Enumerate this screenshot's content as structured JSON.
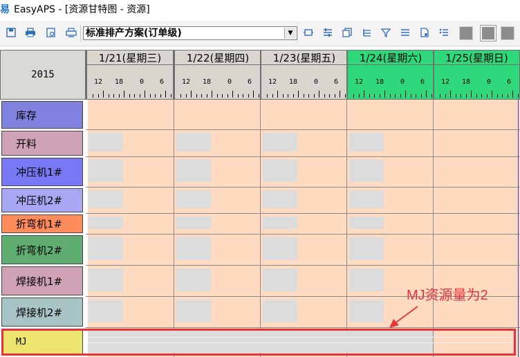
{
  "window": {
    "app_icon": "easyaps-logo-icon",
    "title": "EasyAPS - [资源甘特图 - 资源]"
  },
  "toolbar": {
    "icons_left": [
      "save-icon",
      "print-icon",
      "print-preview-icon",
      "printer-setup-icon"
    ],
    "scheme_value": "标准排产方案(订单级)",
    "dropdown_arrow": "▼",
    "icons_right": [
      "refresh-icon",
      "align-icon",
      "copy-icon",
      "indent-icon",
      "filter-icon",
      "list-icon",
      "document-icon",
      "sort-icon"
    ],
    "view_squares": [
      "view-square-1",
      "view-square-2",
      "view-square-3"
    ]
  },
  "gantt": {
    "year": "2015",
    "days": [
      {
        "label": "1/21(星期三)",
        "highlight": false
      },
      {
        "label": "1/22(星期四)",
        "highlight": false
      },
      {
        "label": "1/23(星期五)",
        "highlight": false
      },
      {
        "label": "1/24(星期六)",
        "highlight": true
      },
      {
        "label": "1/25(星期日)",
        "highlight": true
      }
    ],
    "hour_ticks": [
      "12",
      "18",
      "0",
      "6"
    ],
    "resources": [
      {
        "name": "库存",
        "color": "#8181e0"
      },
      {
        "name": "开料",
        "color": "#cfa2b6"
      },
      {
        "name": "冲压机1#",
        "color": "#7878f5"
      },
      {
        "name": "冲压机2#",
        "color": "#a9a7f4"
      },
      {
        "name": "折弯机1#",
        "color": "#ff8c5a"
      },
      {
        "name": "折弯机2#",
        "color": "#60ad72"
      },
      {
        "name": "焊接机1#",
        "color": "#cfa2b6"
      },
      {
        "name": "焊接机2#",
        "color": "#a9c4c6"
      },
      {
        "name": "MJ",
        "color": "#ece46f"
      }
    ],
    "weekday_header_color": "#d9d6d0",
    "weekend_header_color": "#2fd87b",
    "chart_bg_color": "#fedac0"
  },
  "annotation": {
    "text": "MJ资源量为2",
    "color": "#e8333b"
  }
}
